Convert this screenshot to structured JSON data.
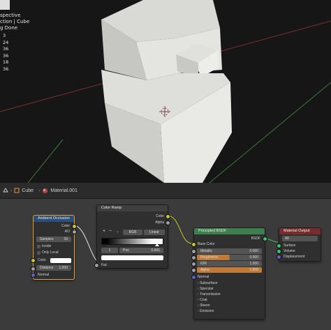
{
  "viewport": {
    "overlay_lines": [
      "spective",
      "ction | Cube",
      "g Done"
    ],
    "stats": [
      "3",
      "24",
      "36",
      "36",
      "18",
      "36"
    ]
  },
  "header": {
    "object": "Cube",
    "material": "Material.001"
  },
  "nodes": {
    "ao": {
      "title": "Ambient Occlusion",
      "out_color": "Color",
      "out_ao": "AO",
      "samples_label": "Samples",
      "samples_value": "16",
      "inside": "Inside",
      "only_local": "Only Local",
      "in_color": "Color",
      "distance_label": "Distance",
      "distance_value": "1.000",
      "normal": "Normal"
    },
    "ramp": {
      "title": "Color Ramp",
      "out_color": "Color",
      "out_alpha": "Alpha",
      "plus": "+",
      "minus": "−",
      "mode": "RGB",
      "interp": "Linear",
      "index": "1",
      "pos_label": "Pos",
      "pos_value": "0.841",
      "fac": "Fac"
    },
    "bsdf": {
      "title": "Principled BSDF",
      "out": "BSDF",
      "base_color": "Base Color",
      "metallic_label": "Metallic",
      "metallic_value": "0.000",
      "roughness_label": "Roughness",
      "roughness_value": "0.500",
      "ior_label": "IOR",
      "ior_value": "1.500",
      "alpha_label": "Alpha",
      "alpha_value": "1.000",
      "normal": "Normal",
      "sections": [
        "Subsurface",
        "Specular",
        "Transmission",
        "Coat",
        "Sheen",
        "Emission"
      ]
    },
    "output": {
      "title": "Material Output",
      "target": "All",
      "surface": "Surface",
      "volume": "Volume",
      "displacement": "Displacement"
    }
  },
  "colors": {
    "ao_header": "#2a4f7a",
    "ramp_header": "#3f3f3f",
    "bsdf_header": "#3e7f4f",
    "output_header": "#7a2c2c",
    "color_socket": "#c7c729",
    "float_socket": "#a1a1a1",
    "shader_socket": "#3fc46e",
    "vector_socket": "#6363c7",
    "selected_outline": "#e8a13a"
  }
}
